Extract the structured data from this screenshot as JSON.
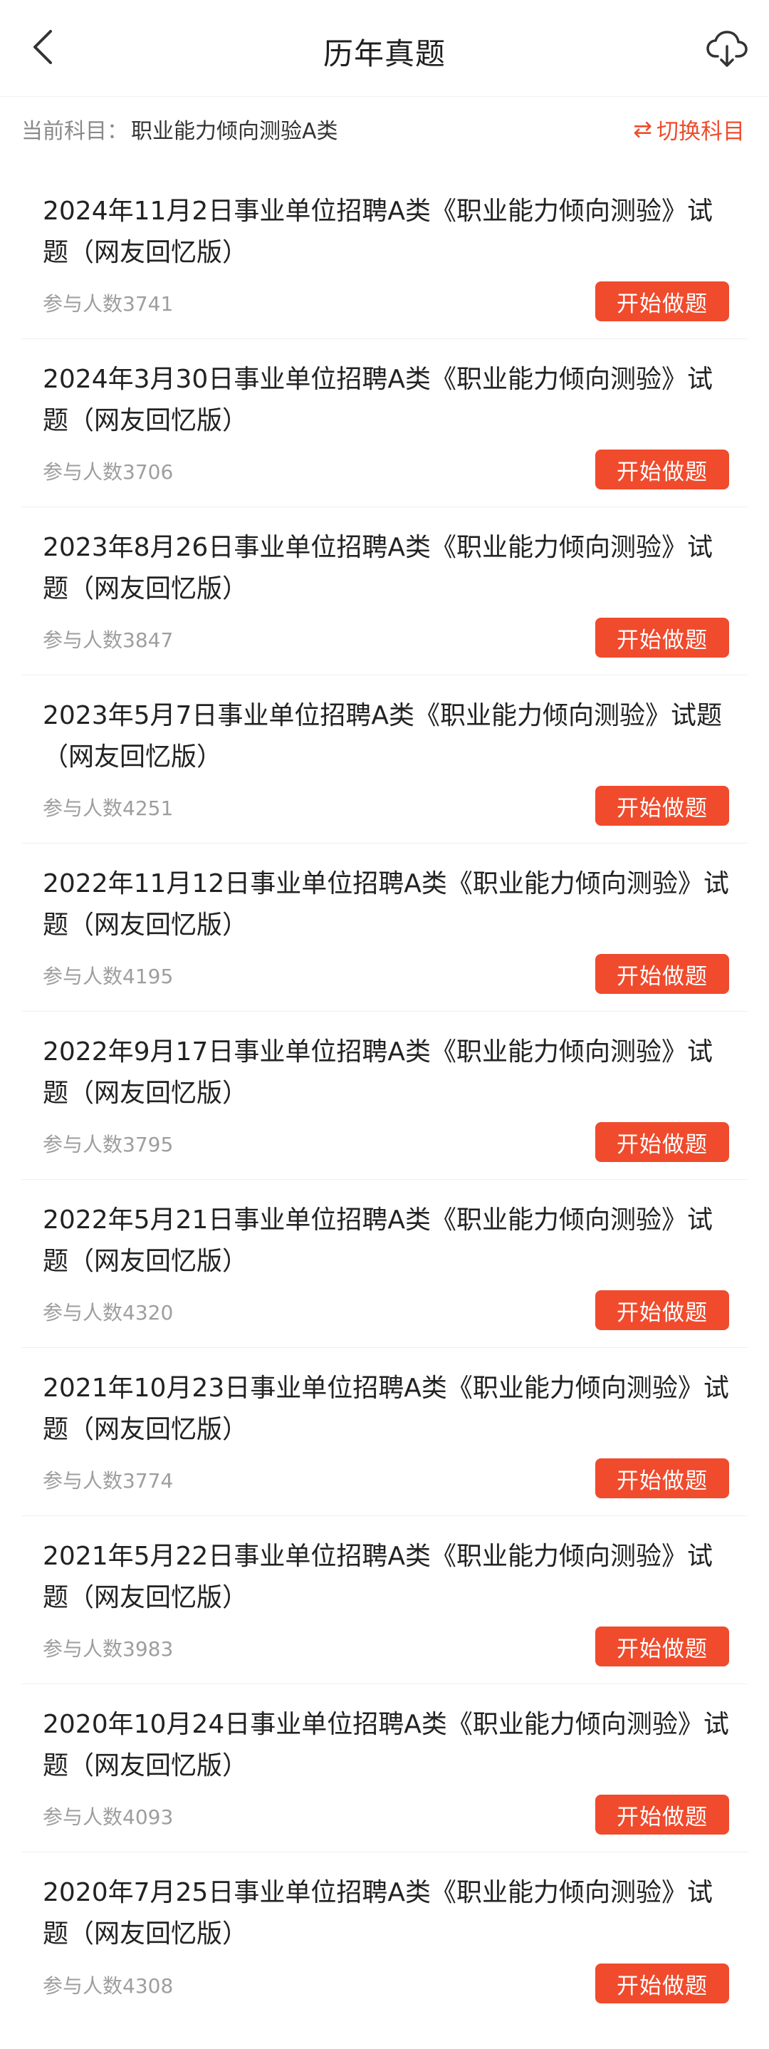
{
  "header": {
    "title": "历年真题",
    "back_icon": "chevron-left-icon",
    "download_icon": "cloud-download-icon"
  },
  "subject": {
    "label": "当前科目：",
    "value": "职业能力倾向测验A类",
    "switch_label": "切换科目",
    "switch_icon": "swap-arrows-icon"
  },
  "colors": {
    "accent": "#f04b2d",
    "switch_text": "#ee4d2d",
    "muted_text": "#9e9e9e"
  },
  "items": [
    {
      "title": "2024年11月2日事业单位招聘A类《职业能力倾向测验》试题（网友回忆版）",
      "count": "参与人数3741",
      "button": "开始做题"
    },
    {
      "title": "2024年3月30日事业单位招聘A类《职业能力倾向测验》试题（网友回忆版）",
      "count": "参与人数3706",
      "button": "开始做题"
    },
    {
      "title": "2023年8月26日事业单位招聘A类《职业能力倾向测验》试题（网友回忆版）",
      "count": "参与人数3847",
      "button": "开始做题"
    },
    {
      "title": "2023年5月7日事业单位招聘A类《职业能力倾向测验》试题（网友回忆版）",
      "count": "参与人数4251",
      "button": "开始做题"
    },
    {
      "title": "2022年11月12日事业单位招聘A类《职业能力倾向测验》试题（网友回忆版）",
      "count": "参与人数4195",
      "button": "开始做题"
    },
    {
      "title": "2022年9月17日事业单位招聘A类《职业能力倾向测验》试题（网友回忆版）",
      "count": "参与人数3795",
      "button": "开始做题"
    },
    {
      "title": "2022年5月21日事业单位招聘A类《职业能力倾向测验》试题（网友回忆版）",
      "count": "参与人数4320",
      "button": "开始做题"
    },
    {
      "title": "2021年10月23日事业单位招聘A类《职业能力倾向测验》试题（网友回忆版）",
      "count": "参与人数3774",
      "button": "开始做题"
    },
    {
      "title": "2021年5月22日事业单位招聘A类《职业能力倾向测验》试题（网友回忆版）",
      "count": "参与人数3983",
      "button": "开始做题"
    },
    {
      "title": "2020年10月24日事业单位招聘A类《职业能力倾向测验》试题（网友回忆版）",
      "count": "参与人数4093",
      "button": "开始做题"
    },
    {
      "title": "2020年7月25日事业单位招聘A类《职业能力倾向测验》试题（网友回忆版）",
      "count": "参与人数4308",
      "button": "开始做题"
    }
  ]
}
